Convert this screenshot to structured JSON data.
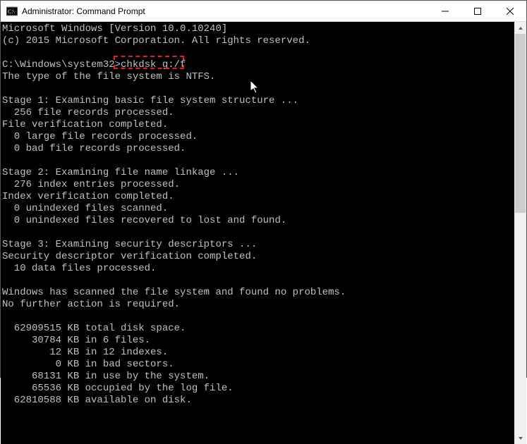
{
  "window": {
    "title": "Administrator: Command Prompt"
  },
  "terminal": {
    "line1": "Microsoft Windows [Version 10.0.10240]",
    "line2": "(c) 2015 Microsoft Corporation. All rights reserved.",
    "blank1": "",
    "promptLine": "C:\\Windows\\system32>chkdsk g:/f",
    "prompt": "C:\\Windows\\system32>",
    "command": "chkdsk g:/f",
    "line4": "The type of the file system is NTFS.",
    "blank2": "",
    "stage1_header": "Stage 1: Examining basic file system structure ...",
    "stage1_a": "  256 file records processed.",
    "stage1_b": "File verification completed.",
    "stage1_c": "  0 large file records processed.",
    "stage1_d": "  0 bad file records processed.",
    "blank3": "",
    "stage2_header": "Stage 2: Examining file name linkage ...",
    "stage2_a": "  276 index entries processed.",
    "stage2_b": "Index verification completed.",
    "stage2_c": "  0 unindexed files scanned.",
    "stage2_d": "  0 unindexed files recovered to lost and found.",
    "blank4": "",
    "stage3_header": "Stage 3: Examining security descriptors ...",
    "stage3_a": "Security descriptor verification completed.",
    "stage3_b": "  10 data files processed.",
    "blank5": "",
    "result_a": "Windows has scanned the file system and found no problems.",
    "result_b": "No further action is required.",
    "blank6": "",
    "space_a": "  62909515 KB total disk space.",
    "space_b": "     30784 KB in 6 files.",
    "space_c": "        12 KB in 12 indexes.",
    "space_d": "         0 KB in bad sectors.",
    "space_e": "     68131 KB in use by the system.",
    "space_f": "     65536 KB occupied by the log file.",
    "space_g": "  62810588 KB available on disk."
  },
  "highlight": {
    "command_text": "chkdsk g:/f"
  }
}
